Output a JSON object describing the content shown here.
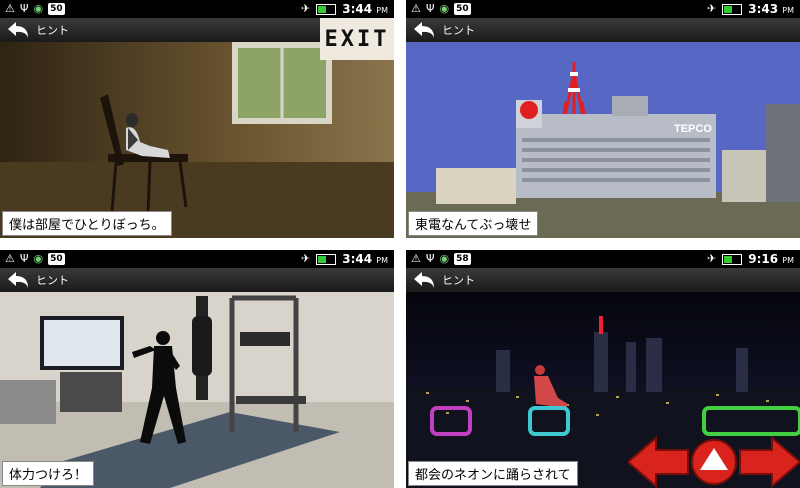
{
  "panels": [
    {
      "status": {
        "badge": "50",
        "time": "3:44",
        "ampm": "PM"
      },
      "nav": {
        "title": "ヒント"
      },
      "caption": "僕は部屋でひとりぼっち。",
      "exit_label": "EXIT"
    },
    {
      "status": {
        "badge": "50",
        "time": "3:43",
        "ampm": "PM"
      },
      "nav": {
        "title": "ヒント"
      },
      "caption": "東電なんてぶっ壊せ",
      "building_sign": "TEPCO"
    },
    {
      "status": {
        "badge": "50",
        "time": "3:44",
        "ampm": "PM"
      },
      "nav": {
        "title": "ヒント"
      },
      "caption": "体力つけろ！"
    },
    {
      "status": {
        "badge": "58",
        "time": "9:16",
        "ampm": "PM"
      },
      "nav": {
        "title": "ヒント"
      },
      "caption": "都会のネオンに踊らされて"
    }
  ],
  "colors": {
    "arrow_red": "#d8241c",
    "box_magenta": "#c040c0",
    "box_cyan": "#40c8d0",
    "box_green": "#40d040"
  },
  "icons": [
    "alert-icon",
    "usb-icon",
    "wifi-icon",
    "airplane-icon",
    "battery-icon",
    "back-arrow-icon",
    "left-arrow-icon",
    "up-arrow-icon",
    "right-arrow-icon"
  ]
}
